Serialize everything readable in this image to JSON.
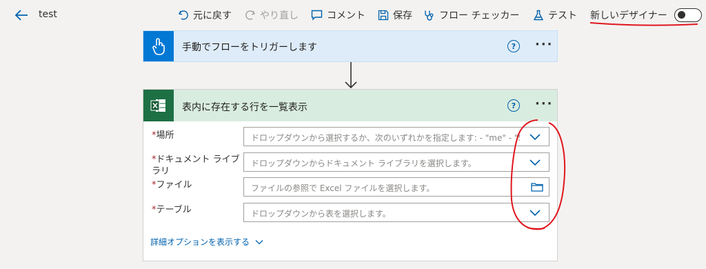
{
  "header": {
    "title": "test",
    "undo": "元に戻す",
    "redo": "やり直し",
    "comment": "コメント",
    "save": "保存",
    "checker": "フロー チェッカー",
    "test": "テスト",
    "new_designer": "新しいデザイナー",
    "toggle_on": false
  },
  "trigger": {
    "title": "手動でフローをトリガーします",
    "help": "?",
    "more": "···"
  },
  "action": {
    "title": "表内に存在する行を一覧表示",
    "help": "?",
    "more": "···",
    "fields": [
      {
        "label": "場所",
        "required": "*",
        "placeholder": "ドロップダウンから選択するか、次のいずれかを指定します: - \"me\" - \"S"
      },
      {
        "label": "ドキュメント ライブラリ",
        "required": "*",
        "placeholder": "ドロップダウンからドキュメント ライブラリを選択します。"
      },
      {
        "label": "ファイル",
        "required": "*",
        "placeholder": "ファイルの参照で Excel ファイルを選択します。"
      },
      {
        "label": "テーブル",
        "required": "*",
        "placeholder": "ドロップダウンから表を選択します。"
      }
    ],
    "advanced": "詳細オプションを表示する"
  },
  "colors": {
    "accent": "#0078d4",
    "excel_green": "#1d7044",
    "annotation_red": "#e0161e"
  }
}
